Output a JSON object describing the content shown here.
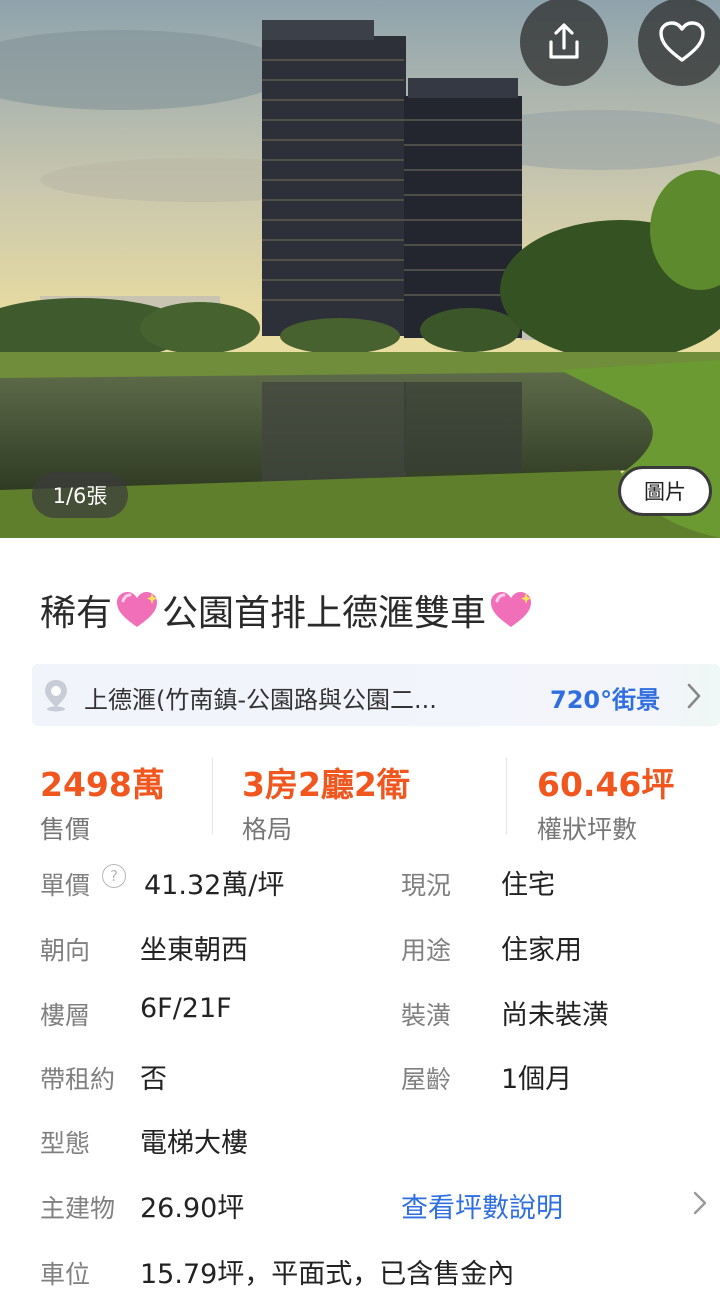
{
  "gallery": {
    "counter": "1/6張",
    "tab_label": "圖片",
    "icons": {
      "share": "share-icon",
      "favorite": "heart-outline-icon"
    }
  },
  "listing": {
    "title_part1": "稀有",
    "title_part2": "公園首排上德滙雙車",
    "title_emoji": "sparkling-heart-icon"
  },
  "address": {
    "text": "上德滙(竹南鎮-公園路與公園二...",
    "street_view": "720°街景",
    "icon": "location-pin-icon"
  },
  "stats": {
    "price_value": "2498萬",
    "price_label": "售價",
    "layout_value": "3房2廳2衛",
    "layout_label": "格局",
    "area_value": "60.46坪",
    "area_label": "權狀坪數"
  },
  "details": {
    "unit_price_label": "單價",
    "unit_price_value": "41.32萬/坪",
    "status_label": "現況",
    "status_value": "住宅",
    "orientation_label": "朝向",
    "orientation_value": "坐東朝西",
    "usage_label": "用途",
    "usage_value": "住家用",
    "floor_label": "樓層",
    "floor_value": "6F/21F",
    "decoration_label": "裝潢",
    "decoration_value": "尚未裝潢",
    "lease_label": "帶租約",
    "lease_value": "否",
    "age_label": "屋齡",
    "age_value": "1個月",
    "type_label": "型態",
    "type_value": "電梯大樓",
    "main_building_label": "主建物",
    "main_building_value": "26.90坪",
    "area_info_link": "查看坪數說明",
    "parking_label": "車位",
    "parking_value": "15.79坪，平面式，已含售金內"
  },
  "colors": {
    "accent_orange": "#f0561d",
    "link_blue": "#2f6fe0",
    "label_gray": "#808080"
  }
}
